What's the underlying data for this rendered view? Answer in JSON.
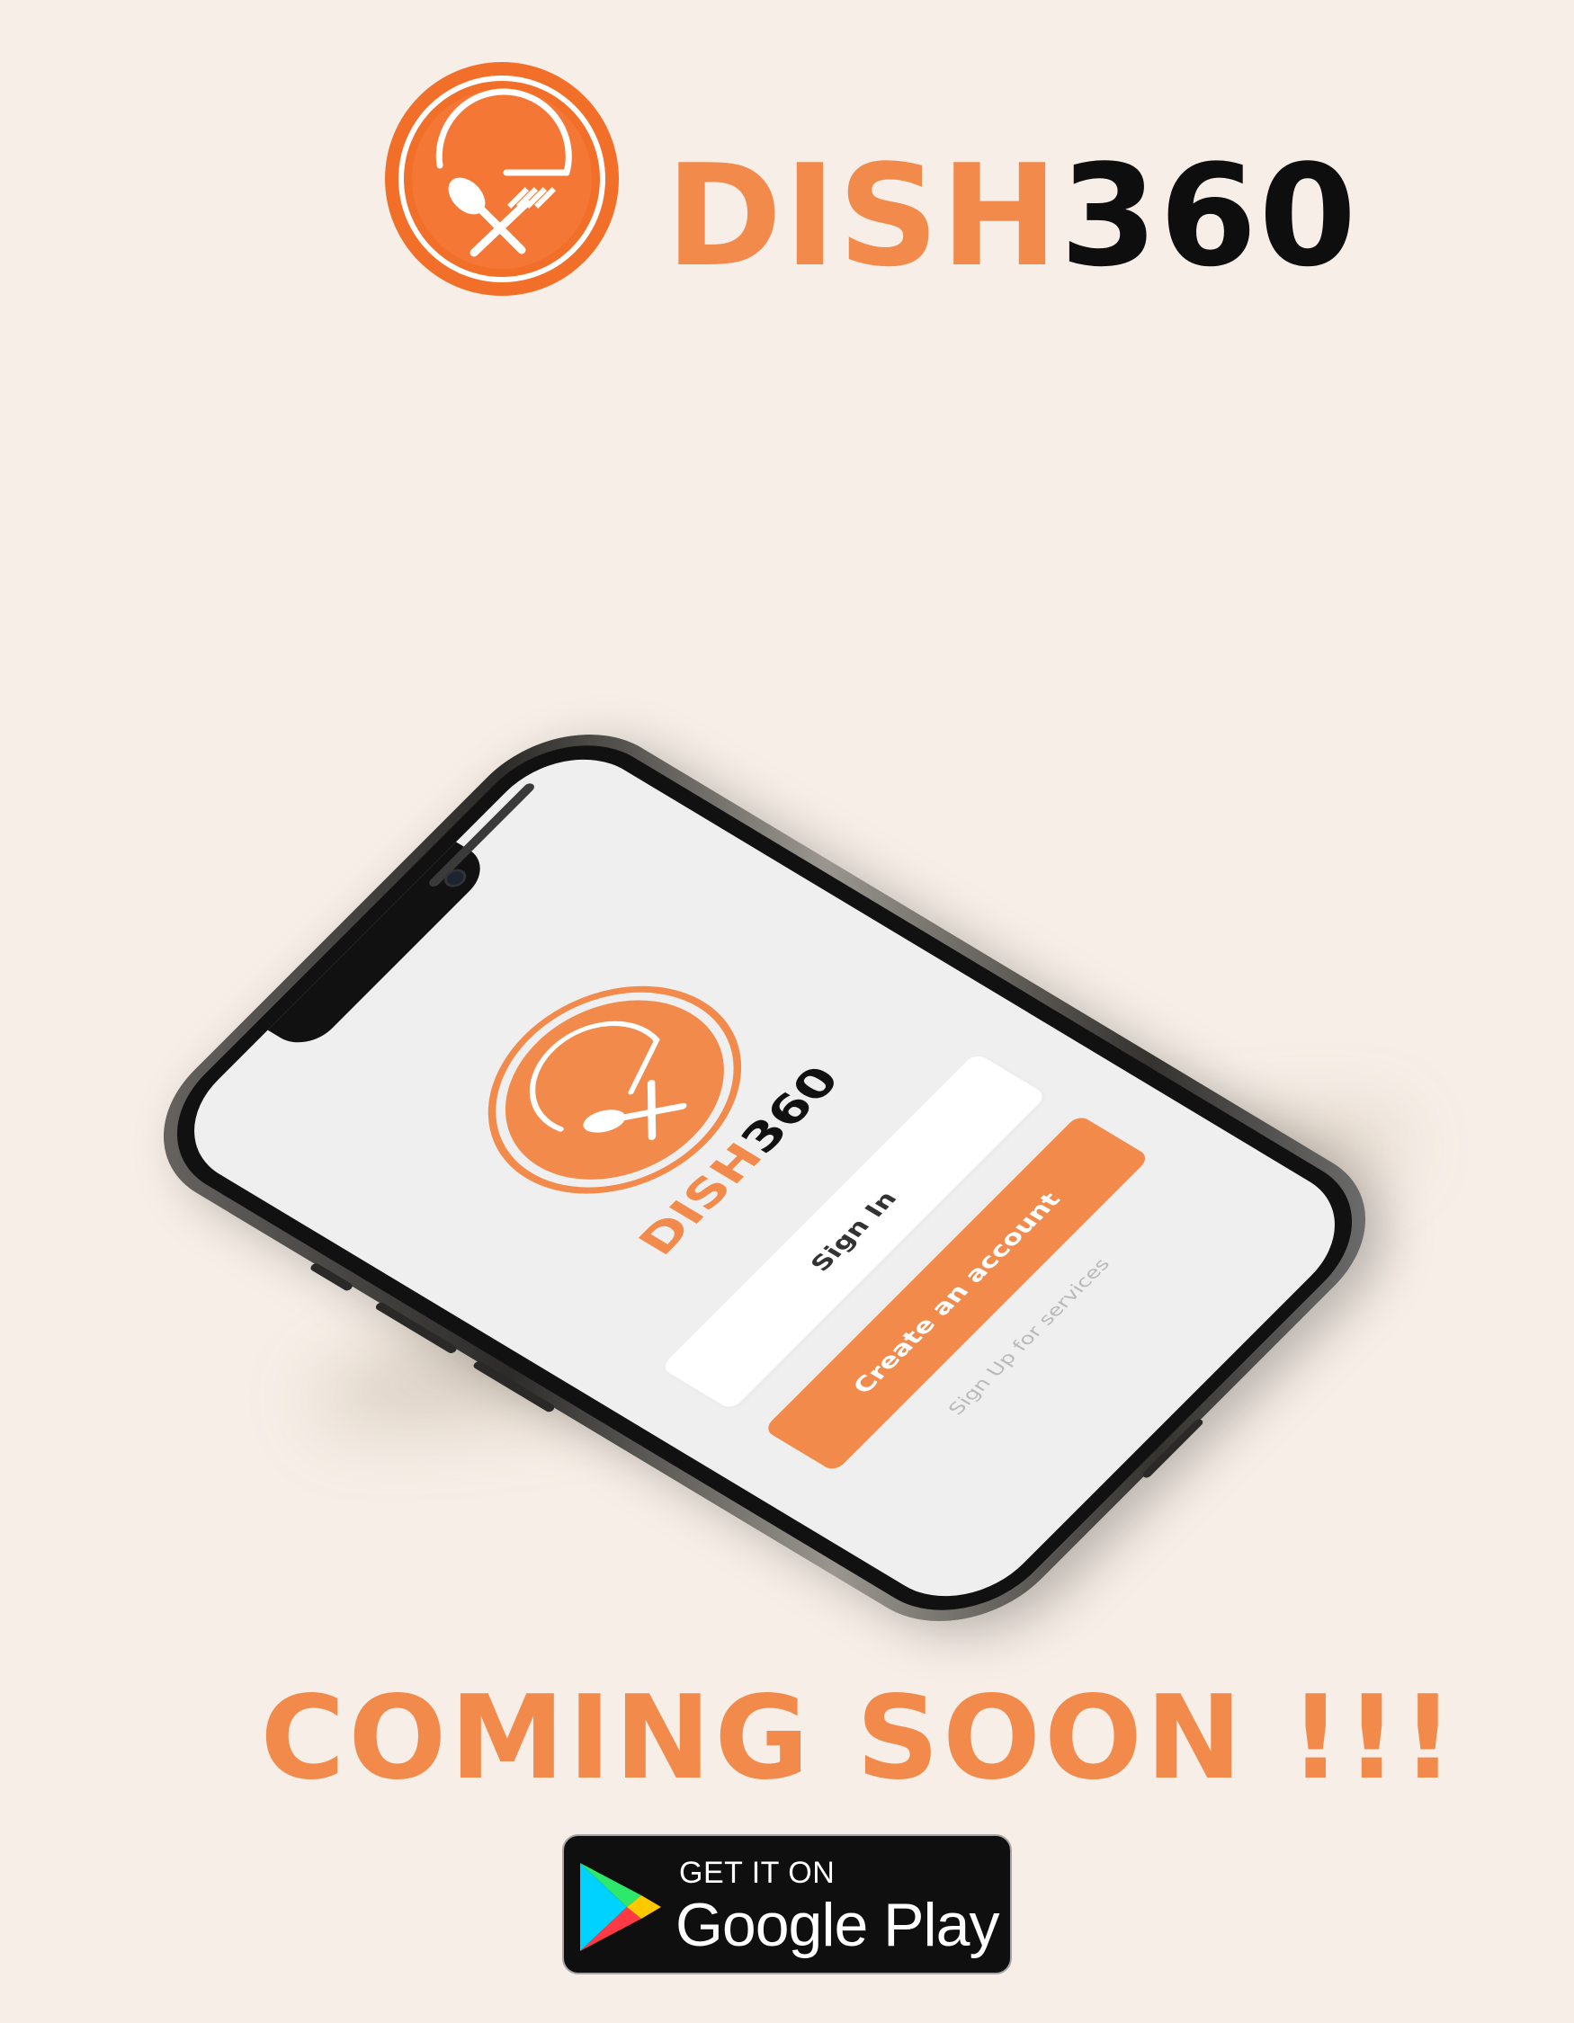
{
  "brand": {
    "name_part1": "DISH",
    "name_part2": "360",
    "logo_icon": "plate-fork-spoon-icon"
  },
  "phone_screen": {
    "brand_part1": "DISH",
    "brand_part2": "360",
    "sign_in_label": "Sign In",
    "create_account_label": "Create an account",
    "signup_link_label": "Sign Up for services"
  },
  "headline": "COMING SOON !!!",
  "store_badge": {
    "top_text": "GET IT ON",
    "main_text": "Google Play",
    "icon": "google-play-icon"
  },
  "colors": {
    "accent": "#f28a4c",
    "background": "#f7efe7",
    "dark": "#0e0e0e"
  }
}
